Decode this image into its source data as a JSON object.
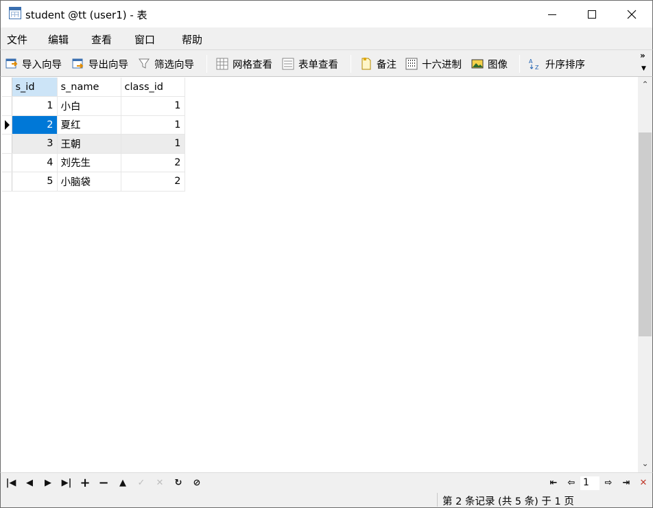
{
  "window": {
    "title": "student @tt (user1) - 表"
  },
  "menu": [
    "文件",
    "编辑",
    "查看",
    "窗口",
    "帮助"
  ],
  "toolbar": {
    "import_wizard": "导入向导",
    "export_wizard": "导出向导",
    "filter_wizard": "筛选向导",
    "grid_view": "网格查看",
    "form_view": "表单查看",
    "memo": "备注",
    "hex": "十六进制",
    "image": "图像",
    "sort_asc": "升序排序",
    "more": "»"
  },
  "grid": {
    "columns": [
      "s_id",
      "s_name",
      "class_id"
    ],
    "rows": [
      {
        "s_id": "1",
        "s_name": "小白",
        "class_id": "1"
      },
      {
        "s_id": "2",
        "s_name": "夏红",
        "class_id": "1"
      },
      {
        "s_id": "3",
        "s_name": "王朝",
        "class_id": "1"
      },
      {
        "s_id": "4",
        "s_name": "刘先生",
        "class_id": "2"
      },
      {
        "s_id": "5",
        "s_name": "小脑袋",
        "class_id": "2"
      }
    ],
    "current_row": 2
  },
  "pager": {
    "page": "1"
  },
  "status": {
    "text": "第 2 条记录 (共 5 条) 于 1 页"
  }
}
